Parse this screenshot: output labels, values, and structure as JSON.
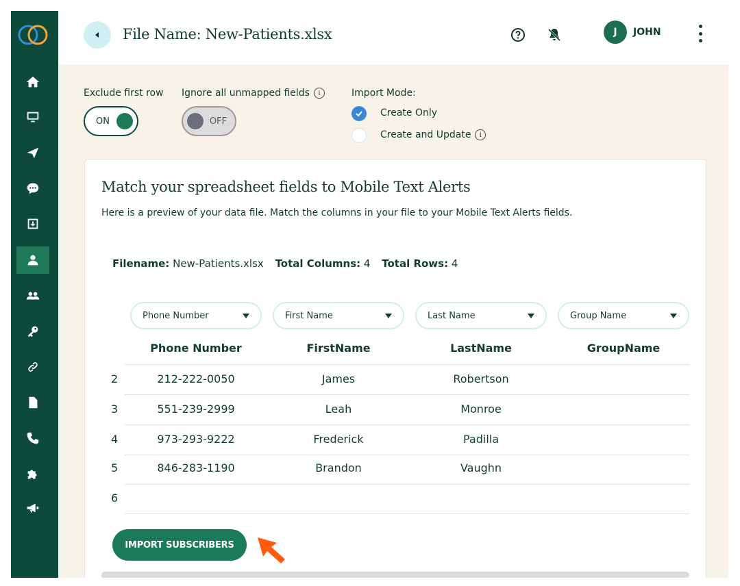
{
  "header": {
    "title": "File Name: New-Patients.xlsx",
    "user_initial": "J",
    "user_name": "JOHN"
  },
  "sidebar": {
    "items": [
      {
        "icon": "home-icon"
      },
      {
        "icon": "monitor-icon"
      },
      {
        "icon": "send-icon"
      },
      {
        "icon": "chat-icon"
      },
      {
        "icon": "inbox-icon"
      },
      {
        "icon": "user-icon",
        "active": true
      },
      {
        "icon": "users-icon"
      },
      {
        "icon": "key-icon"
      },
      {
        "icon": "link-icon"
      },
      {
        "icon": "document-icon"
      },
      {
        "icon": "phone-icon"
      },
      {
        "icon": "puzzle-icon"
      },
      {
        "icon": "megaphone-icon"
      }
    ]
  },
  "options": {
    "exclude_label": "Exclude first row",
    "exclude_state": "ON",
    "ignore_label": "Ignore all unmapped fields",
    "ignore_state": "OFF",
    "import_mode_label": "Import Mode:",
    "mode_options": [
      "Create Only",
      "Create and Update"
    ],
    "mode_selected": "Create Only"
  },
  "card": {
    "title": "Match your spreadsheet fields to Mobile Text Alerts",
    "subtitle": "Here is a preview of your data file. Match the columns in your file to your Mobile Text Alerts fields.",
    "filename_label": "Filename:",
    "filename": "New-Patients.xlsx",
    "total_columns_label": "Total Columns:",
    "total_columns": "4",
    "total_rows_label": "Total Rows:",
    "total_rows": "4"
  },
  "mapping": {
    "selects": [
      "Phone Number",
      "First Name",
      "Last Name",
      "Group Name"
    ],
    "headers": [
      "Phone Number",
      "FirstName",
      "LastName",
      "GroupName"
    ],
    "rows": [
      {
        "num": "2",
        "cells": [
          "212-222-0050",
          "James",
          "Robertson",
          ""
        ]
      },
      {
        "num": "3",
        "cells": [
          "551-239-2999",
          "Leah",
          "Monroe",
          ""
        ]
      },
      {
        "num": "4",
        "cells": [
          "973-293-9222",
          "Frederick",
          "Padilla",
          ""
        ]
      },
      {
        "num": "5",
        "cells": [
          "846-283-1190",
          "Brandon",
          "Vaughn",
          ""
        ]
      },
      {
        "num": "6",
        "cells": [
          "",
          "",
          "",
          ""
        ]
      }
    ]
  },
  "actions": {
    "import_label": "IMPORT SUBSCRIBERS"
  },
  "colors": {
    "sidebar": "#0d4a3a",
    "accent": "#1b7a5a",
    "background": "#f7f3e9",
    "arrow": "#ff5a10"
  }
}
